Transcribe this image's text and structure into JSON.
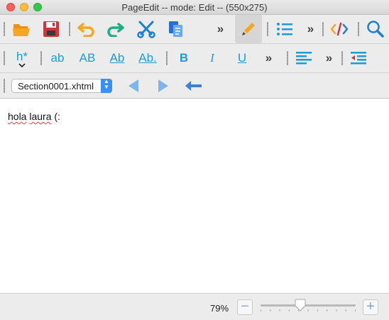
{
  "window": {
    "title": "PageEdit -- mode: Edit -- (550x275)"
  },
  "toolbar1": {
    "icons": [
      "open-folder-icon",
      "save-icon",
      "undo-icon",
      "redo-icon",
      "cut-icon",
      "paste-icon",
      "more-chevron-icon",
      "pencil-icon",
      "list-icon",
      "more-chevron-icon",
      "code-view-icon",
      "search-icon"
    ],
    "chevron": "»"
  },
  "toolbar2": {
    "heading_label": "h*",
    "lowercase_label": "ab",
    "uppercase_label": "AB",
    "titlecase_label": "Ab",
    "sentencecase_label": "Ab.",
    "bold_label": "B",
    "italic_label": "I",
    "underline_label": "U",
    "chevron": "»"
  },
  "navbar": {
    "file_select": {
      "value": "Section0001.xhtml",
      "options": [
        "Section0001.xhtml"
      ]
    }
  },
  "document": {
    "words": [
      "hola",
      "laura",
      "(:"
    ]
  },
  "status": {
    "zoom_percent": "79%",
    "zoom_level": 0.42,
    "zoom_out_label": "−",
    "zoom_in_label": "+"
  },
  "colors": {
    "accent": "#1e9bd7",
    "folder": "#f5a623",
    "save": "#d0343c",
    "undo": "#f5a623",
    "redo": "#1fae84",
    "nav_arrow": "#7fb5e8",
    "back_arrow": "#3f7fd9"
  }
}
